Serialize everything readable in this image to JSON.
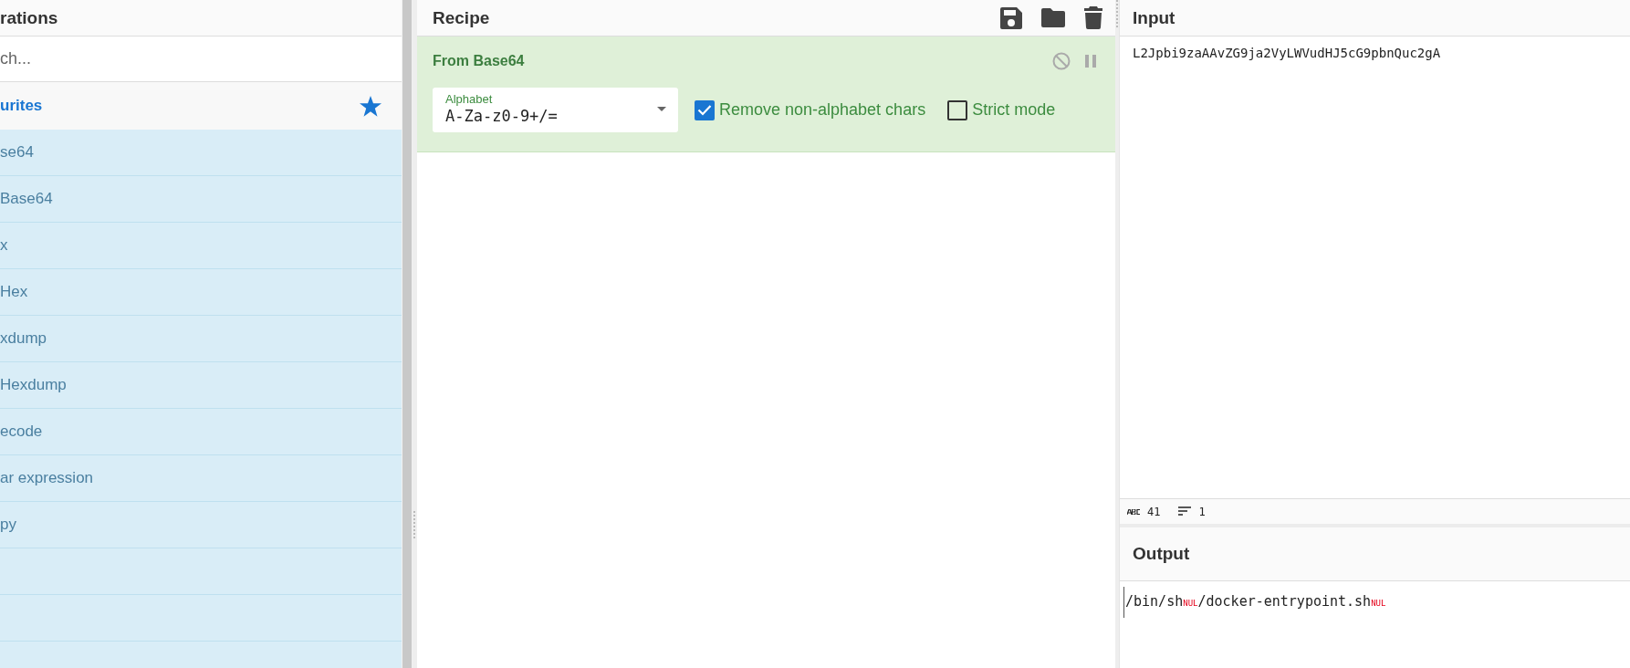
{
  "operations": {
    "title": "rations",
    "search": {
      "placeholder": "ch..."
    },
    "favourites": {
      "label": "urites"
    },
    "items": [
      {
        "label": "se64"
      },
      {
        "label": "Base64"
      },
      {
        "label": "x"
      },
      {
        "label": "Hex"
      },
      {
        "label": "xdump"
      },
      {
        "label": "Hexdump"
      },
      {
        "label": "ecode"
      },
      {
        "label": "ar expression"
      },
      {
        "label": "py"
      }
    ]
  },
  "recipe": {
    "title": "Recipe",
    "operations": [
      {
        "name": "From Base64",
        "args": [
          {
            "kind": "dropdown",
            "label": "Alphabet",
            "value": "A-Za-z0-9+/="
          },
          {
            "kind": "checkbox",
            "label": "Remove non-alphabet chars",
            "checked": true
          },
          {
            "kind": "checkbox",
            "label": "Strict mode",
            "checked": false
          }
        ]
      }
    ]
  },
  "input": {
    "title": "Input",
    "value": "L2Jpbi9zaAAvZG9ja2VyLWVudHJ5cG9pbnQuc2gA",
    "status": {
      "length": "41",
      "lines": "1"
    }
  },
  "output": {
    "title": "Output",
    "segments": [
      {
        "kind": "text",
        "text": "/bin/sh"
      },
      {
        "kind": "control",
        "text": "NUL"
      },
      {
        "kind": "text",
        "text": "/docker-entrypoint.sh"
      },
      {
        "kind": "control",
        "text": "NUL"
      }
    ]
  }
}
